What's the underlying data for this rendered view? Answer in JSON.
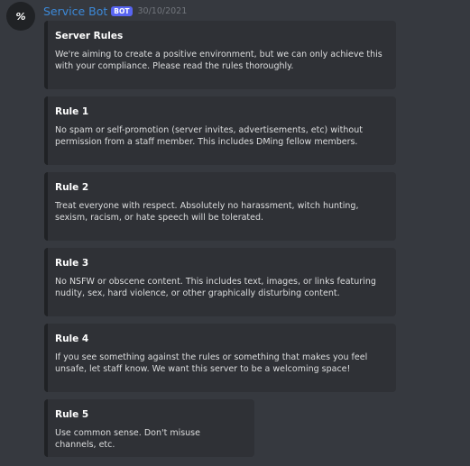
{
  "author": {
    "avatar_text": "%",
    "name": "Service Bot",
    "tag": "BOT",
    "timestamp": "30/10/2021"
  },
  "embeds": [
    {
      "title": "Server Rules",
      "description": "We're aiming to create a positive environment, but we can only achieve this with your compliance. Please read the rules thoroughly."
    },
    {
      "title": "Rule 1",
      "description": "No spam or self-promotion (server invites, advertisements, etc) without permission from a staff member. This includes DMing fellow members."
    },
    {
      "title": "Rule 2",
      "description": "Treat everyone with respect. Absolutely no harassment, witch hunting, sexism, racism, or hate speech will be tolerated."
    },
    {
      "title": "Rule 3",
      "description": "No NSFW or obscene content. This includes text, images, or links featuring nudity, sex, hard violence, or other graphically disturbing content."
    },
    {
      "title": "Rule 4",
      "description": "If you see something against the rules or something that makes you feel unsafe, let staff know. We want this server to be a welcoming space!"
    },
    {
      "title": "Rule 5",
      "description": "Use common sense. Don't misuse channels, etc."
    }
  ],
  "colors": {
    "background": "#36393f",
    "embed_background": "#2f3136",
    "embed_border": "#202225",
    "username": "#3c89d8",
    "bot_tag": "#5865f2",
    "title": "#ffffff",
    "text": "#dcddde",
    "timestamp": "#72767d"
  }
}
